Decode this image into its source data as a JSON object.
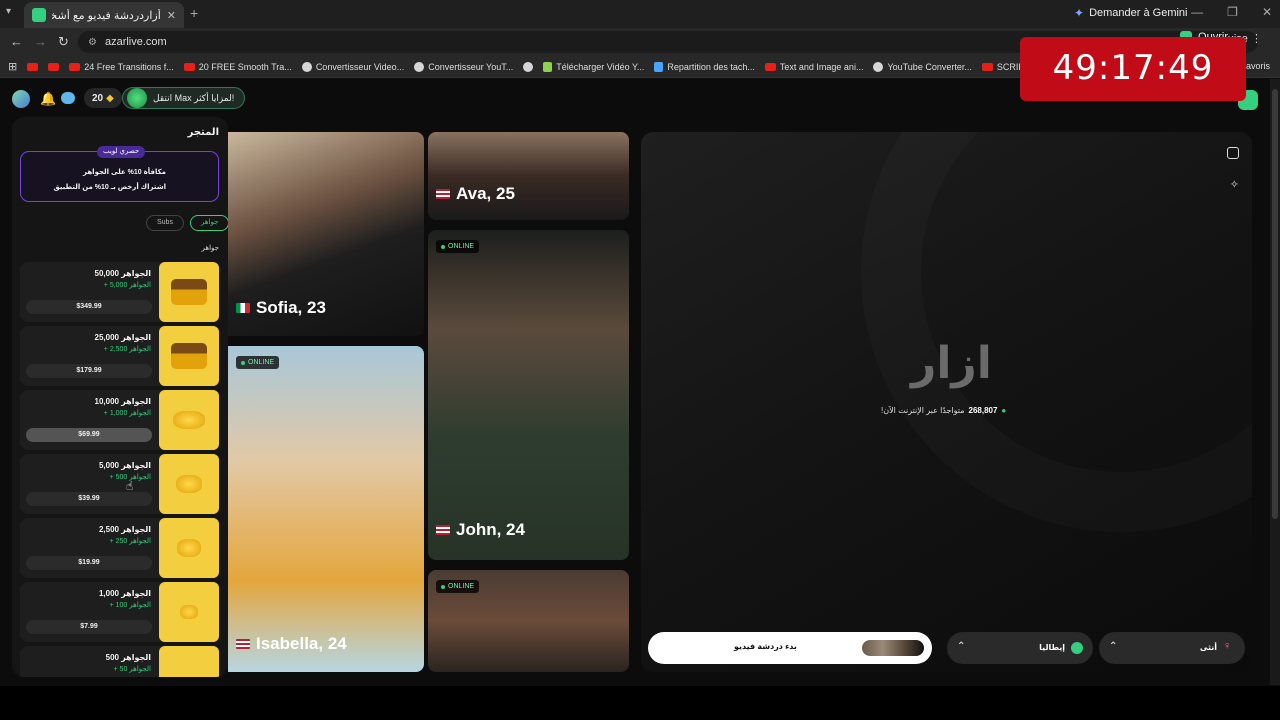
{
  "browser": {
    "tab_title": "أزاردردشة فيديو مع أشخاص جدد",
    "gemini_label": "Demander à Gemini",
    "url": "azarlive.com",
    "open_label": "Ouvrir",
    "extra_label": "uise",
    "bookmarks": [
      {
        "label": "",
        "icon": "youtube-icon"
      },
      {
        "label": "",
        "icon": "youtube-icon"
      },
      {
        "label": "24 Free Transitions f...",
        "icon": "youtube-icon"
      },
      {
        "label": "20 FREE Smooth Tra...",
        "icon": "youtube-icon"
      },
      {
        "label": "Convertisseur Video...",
        "icon": "globe-icon"
      },
      {
        "label": "Convertisseur YouT...",
        "icon": "globe-icon"
      },
      {
        "label": "",
        "icon": "globe-icon"
      },
      {
        "label": "Télécharger Vidéo Y...",
        "icon": "download-icon"
      },
      {
        "label": "Repartition des tach...",
        "icon": "notes-icon"
      },
      {
        "label": "Text and Image ani...",
        "icon": "youtube-icon"
      },
      {
        "label": "YouTube Converter...",
        "icon": "globe-icon"
      },
      {
        "label": "SCRIBBLE Animatio...",
        "icon": "youtube-icon"
      }
    ],
    "bookmarks_tail": "favoris"
  },
  "timer": "49:17:49",
  "header": {
    "gems_count": "20",
    "max_label": "انتقل Max لمزايا أكثر!"
  },
  "store": {
    "title": "المتجر",
    "promo_badge": "حصري لويب",
    "promo_line1": "مكافأة 10% على الجواهر",
    "promo_line2": "اشتراك أرخص بـ 10% من التطبيق",
    "tab_gems": "جواهر",
    "tab_subs": "Subs",
    "section_label": "جواهر",
    "packs": [
      {
        "amount": "50,000 الجواهر",
        "bonus": "+ 5,000 الجواهر",
        "price": "$349.99",
        "image": "gem-chest"
      },
      {
        "amount": "25,000 الجواهر",
        "bonus": "+ 2,500 الجواهر",
        "price": "$179.99",
        "image": "gem-chest"
      },
      {
        "amount": "10,000 الجواهر",
        "bonus": "+ 1,000 الجواهر",
        "price": "$69.99",
        "image": "gem-pile"
      },
      {
        "amount": "5,000 الجواهر",
        "bonus": "+ 500 الجواهر",
        "price": "$39.99",
        "image": "gem-pile"
      },
      {
        "amount": "2,500 الجواهر",
        "bonus": "+ 250 الجواهر",
        "price": "$19.99",
        "image": "gem-pile"
      },
      {
        "amount": "1,000 الجواهر",
        "bonus": "+ 100 الجواهر",
        "price": "$7.99",
        "image": "gem-single"
      },
      {
        "amount": "500 الجواهر",
        "bonus": "+ 50 الجواهر",
        "price": "",
        "image": "gem-single"
      }
    ]
  },
  "profiles": {
    "sofia": {
      "name": "Sofia, 23",
      "flag": "italy"
    },
    "ava": {
      "name": "Ava, 25",
      "flag": "usa"
    },
    "isabella": {
      "name": "Isabella, 24",
      "flag": "usa",
      "status": "ONLINE"
    },
    "john": {
      "name": "John, 24",
      "flag": "usa",
      "status": "ONLINE"
    },
    "last": {
      "status": "ONLINE"
    }
  },
  "video": {
    "logo_text": "ازار",
    "online_count": "268,807",
    "online_text": "متواجدًا عبر الإنترنت الآن!"
  },
  "controls": {
    "start_label": "بدء دردشة فيديو",
    "country_label": "إيطاليا",
    "gender_label": "أنثى"
  },
  "colors": {
    "accent": "#35d07f",
    "promo_border": "#7b3fe0",
    "timer_bg": "#c10c18",
    "gem_bg": "#f3cf3f"
  }
}
